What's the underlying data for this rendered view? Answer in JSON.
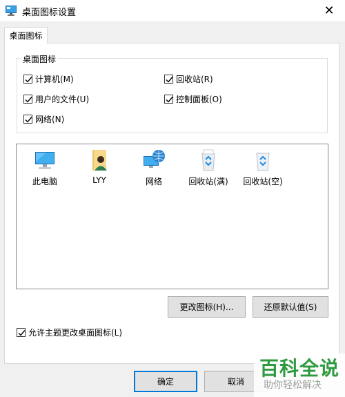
{
  "window": {
    "title": "桌面图标设置",
    "close": "✕"
  },
  "tab": {
    "label": "桌面图标"
  },
  "desktop_icons_group": {
    "title": "桌面图标",
    "checkboxes": [
      {
        "label": "计算机(M)",
        "checked": true
      },
      {
        "label": "回收站(R)",
        "checked": true
      },
      {
        "label": "用户的文件(U)",
        "checked": true
      },
      {
        "label": "控制面板(O)",
        "checked": true
      },
      {
        "label": "网络(N)",
        "checked": true
      }
    ]
  },
  "icon_list": [
    {
      "label": "此电脑",
      "icon": "computer-icon"
    },
    {
      "label": "LYY",
      "icon": "user-folder-icon"
    },
    {
      "label": "网络",
      "icon": "network-icon"
    },
    {
      "label": "回收站(满)",
      "icon": "recycle-bin-full-icon"
    },
    {
      "label": "回收站(空)",
      "icon": "recycle-bin-empty-icon"
    }
  ],
  "buttons": {
    "change_icon": "更改图标(H)...",
    "restore_default": "还原默认值(S)",
    "ok": "确定",
    "cancel": "取消"
  },
  "allow_themes": {
    "label": "允许主题更改桌面图标(L)",
    "checked": true
  },
  "watermark": {
    "main": "百科全说",
    "sub": "助你轻松解决"
  },
  "colors": {
    "accent": "#0078d7",
    "watermark_green": "#2e9a3f"
  }
}
